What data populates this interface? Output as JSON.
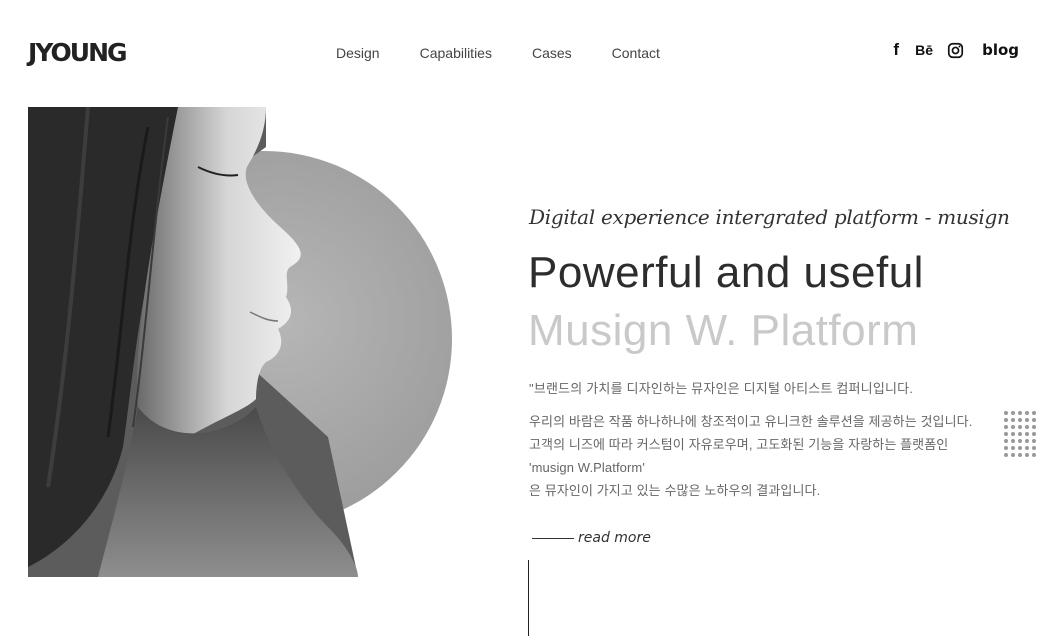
{
  "header": {
    "logo": "JYOUNG",
    "nav": [
      "Design",
      "Capabilities",
      "Cases",
      "Contact"
    ],
    "social": {
      "facebook": "f",
      "behance": "Bē",
      "instagram_icon": "instagram-icon",
      "blog": "blog"
    }
  },
  "hero": {
    "tagline": "Digital experience intergrated platform - musign",
    "headline_1": "Powerful and useful",
    "headline_2": "Musign W. Platform",
    "quote": "\"브랜드의 가치를 디자인하는 뮤자인은 디지털 아티스트 컴퍼니입니다.",
    "description": [
      "우리의 바람은 작품 하나하나에 창조적이고 유니크한 솔루션을 제공하는 것입니다.",
      "고객의 니즈에 따라 커스텀이 자유로우며, 고도화된 기능을 자랑하는 플랫폼인",
      "'musign W.Platform'",
      "은 뮤자인이 가지고 있는 수많은 노하우의 결과입니다."
    ],
    "read_more": "read more",
    "image": "black-and-white-portrait-of-woman-profile",
    "accent_colors": {
      "headline": "#2d2d2d",
      "headline_faded": "#c9c9c9",
      "circle": "#a7a7a7"
    }
  }
}
